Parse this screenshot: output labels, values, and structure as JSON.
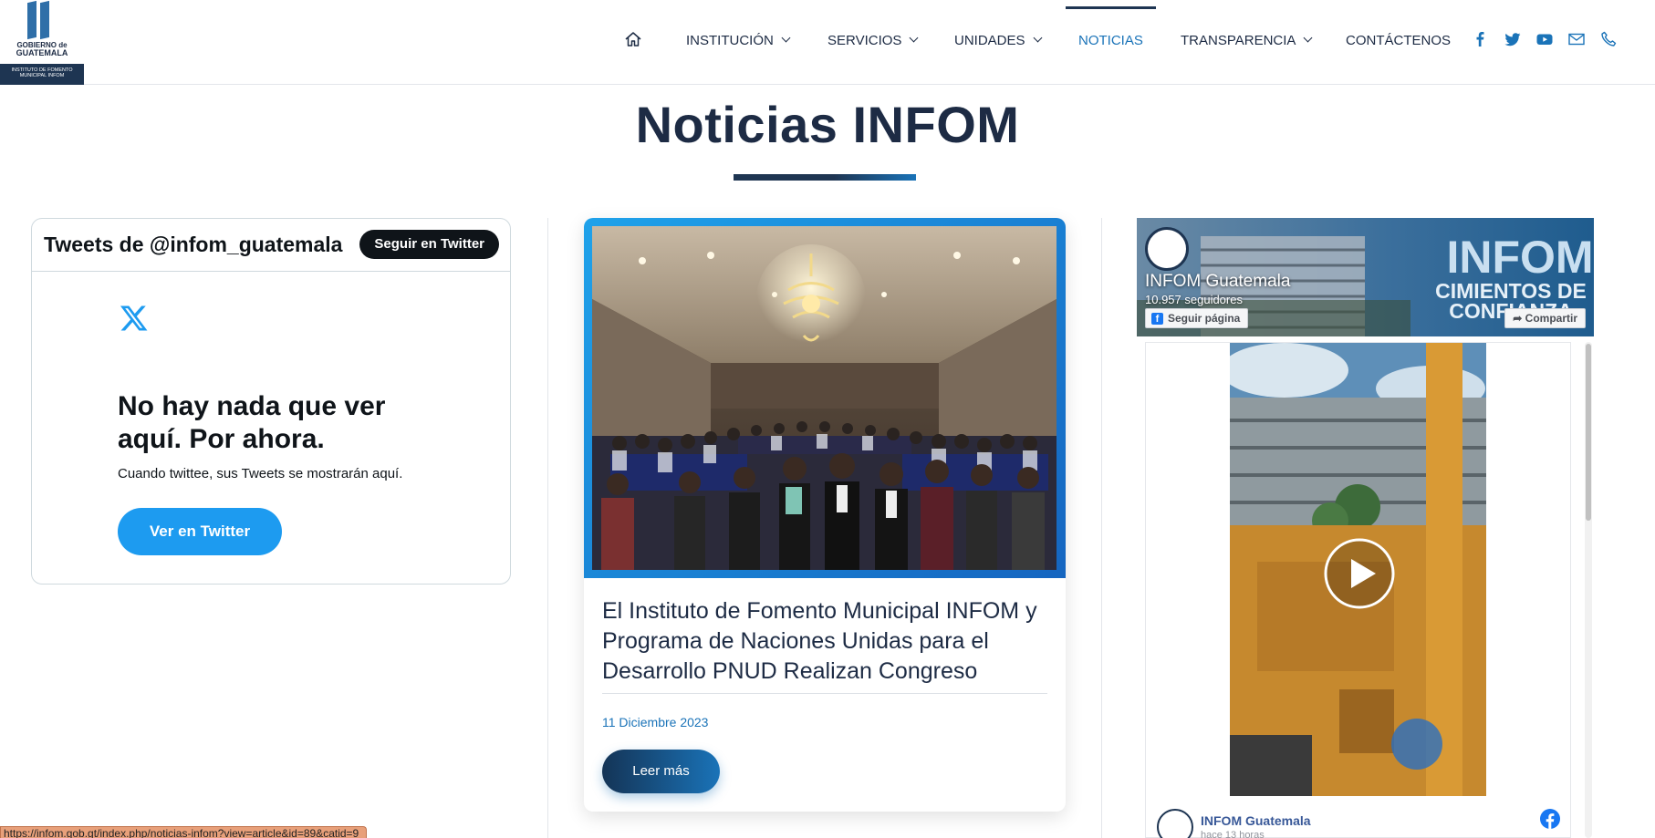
{
  "header": {
    "logo": {
      "line1": "GOBIERNO de",
      "line2": "GUATEMALA",
      "sub": "INSTITUTO DE FOMENTO MUNICIPAL INFOM"
    },
    "nav": [
      {
        "label": "INSTITUCIÓN",
        "dropdown": true
      },
      {
        "label": "SERVICIOS",
        "dropdown": true
      },
      {
        "label": "UNIDADES",
        "dropdown": true
      },
      {
        "label": "NOTICIAS",
        "dropdown": false,
        "active": true
      },
      {
        "label": "TRANSPARENCIA",
        "dropdown": true
      },
      {
        "label": "CONTÁCTENOS",
        "dropdown": false
      }
    ],
    "social_icons": [
      "facebook-icon",
      "twitter-icon",
      "youtube-icon",
      "mail-icon",
      "phone-icon"
    ]
  },
  "page_title": "Noticias INFOM",
  "twitter": {
    "title": "Tweets de @infom_guatemala",
    "follow_label": "Seguir en Twitter",
    "empty_title": "No hay nada que ver aquí. Por ahora.",
    "empty_sub": "Cuando twittee, sus Tweets se mostrarán aquí.",
    "view_label": "Ver en Twitter"
  },
  "news": {
    "title": "El Instituto de Fomento Municipal INFOM y Programa de Naciones Unidas para el Desarrollo PNUD Realizan Congreso",
    "date": "11 Diciembre 2023",
    "button_label": "Leer más"
  },
  "facebook": {
    "page_name": "INFOM Guatemala",
    "followers": "10.957 seguidores",
    "follow_label": "Seguir página",
    "share_label": "Compartir",
    "cover_text1": "INFOM",
    "cover_text2": "CIMIENTOS DE",
    "cover_text3": "CONFIANZA",
    "post_name": "INFOM Guatemala",
    "post_time": "hace 13 horas"
  },
  "status_url": "https://infom.gob.gt/index.php/noticias-infom?view=article&id=89&catid=9",
  "colors": {
    "navy": "#1e3552",
    "accent": "#1a73b8",
    "twitter_blue": "#1d9bf0",
    "facebook_blue": "#1877f2"
  }
}
